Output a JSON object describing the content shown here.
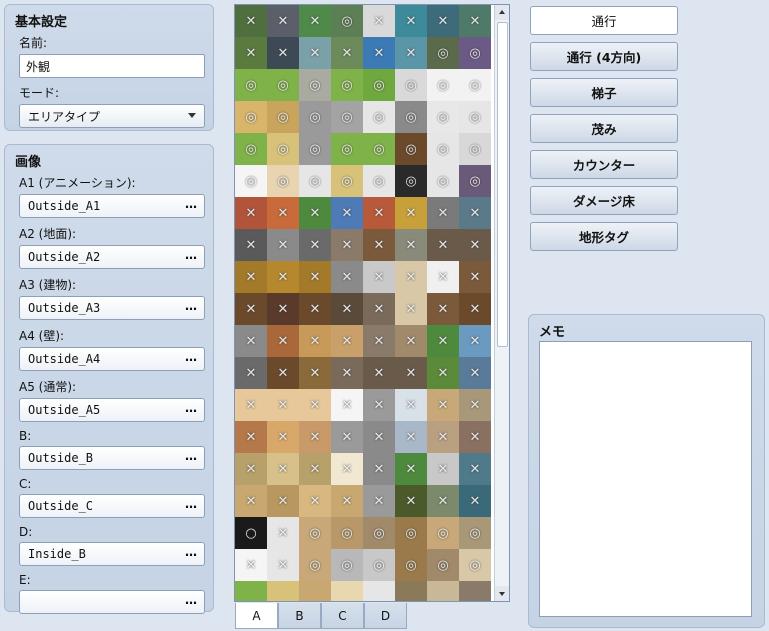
{
  "basic": {
    "title": "基本設定",
    "name_label": "名前:",
    "name_value": "外観",
    "mode_label": "モード:",
    "mode_value": "エリアタイプ"
  },
  "images": {
    "title": "画像",
    "browse_label": "…",
    "items": [
      {
        "label": "A1 (アニメーション):",
        "value": "Outside_A1"
      },
      {
        "label": "A2 (地面):",
        "value": "Outside_A2"
      },
      {
        "label": "A3 (建物):",
        "value": "Outside_A3"
      },
      {
        "label": "A4 (壁):",
        "value": "Outside_A4"
      },
      {
        "label": "A5 (通常):",
        "value": "Outside_A5"
      },
      {
        "label": "B:",
        "value": "Outside_B"
      },
      {
        "label": "C:",
        "value": "Outside_C"
      },
      {
        "label": "D:",
        "value": "Inside_B"
      },
      {
        "label": "E:",
        "value": ""
      }
    ]
  },
  "tileset": {
    "tabs": [
      "A",
      "B",
      "C",
      "D"
    ],
    "active_tab": "A",
    "rows": [
      {
        "colors": [
          "#4f6f3e",
          "#5a5f6a",
          "#4f8a4a",
          "#5d7f55",
          "#d9d9d9",
          "#3c8a9a",
          "#3d6b7a",
          "#4f7a6a"
        ],
        "marks": [
          "✕",
          "✕",
          "✕",
          "◎",
          "✕",
          "✕",
          "✕",
          "✕"
        ]
      },
      {
        "colors": [
          "#5a7a3e",
          "#3d4a55",
          "#7aa0a8",
          "#6c8a5a",
          "#3b7ab5",
          "#5b95a8",
          "#5a6a4a",
          "#6b5a85"
        ],
        "marks": [
          "✕",
          "✕",
          "✕",
          "✕",
          "✕",
          "✕",
          "◎",
          "◎"
        ]
      },
      {
        "colors": [
          "#7fb34a",
          "#7fb34a",
          "#a9aaa0",
          "#7fb34a",
          "#6fa83e",
          "#d9d9d9",
          "#f2f2f2",
          "#f2f2f2"
        ],
        "marks": [
          "◎",
          "◎",
          "◎",
          "◎",
          "◎",
          "◎",
          "◎",
          "◎"
        ]
      },
      {
        "colors": [
          "#d8b56a",
          "#c9a45c",
          "#9a9a9a",
          "#a3a3a3",
          "#e6e6e6",
          "#8a8a8a",
          "#e8e8e8",
          "#e6e6e6"
        ],
        "marks": [
          "◎",
          "◎",
          "◎",
          "◎",
          "◎",
          "◎",
          "◎",
          "◎"
        ]
      },
      {
        "colors": [
          "#7fb34a",
          "#d8c27a",
          "#9a9a9a",
          "#7fb34a",
          "#7fb34a",
          "#6a4a2a",
          "#e6e6e6",
          "#d8d8d8"
        ],
        "marks": [
          "◎",
          "◎",
          "◎",
          "◎",
          "◎",
          "◎",
          "◎",
          "◎"
        ]
      },
      {
        "colors": [
          "#f5f5f5",
          "#e8d4b0",
          "#e6e6e6",
          "#d8c27a",
          "#e6e6e6",
          "#2a2a2a",
          "#e6e6e6",
          "#6a5a7a"
        ],
        "marks": [
          "◎",
          "◎",
          "◎",
          "◎",
          "◎",
          "◎",
          "◎",
          "◎"
        ]
      },
      {
        "colors": [
          "#b2543a",
          "#c86a3a",
          "#4e8a3e",
          "#4e7ab5",
          "#b85a3a",
          "#c8a03a",
          "#7a7a7a",
          "#5a7a8a"
        ],
        "marks": [
          "✕",
          "✕",
          "✕",
          "✕",
          "✕",
          "✕",
          "✕",
          "✕"
        ]
      },
      {
        "colors": [
          "#5a5a5a",
          "#8a8a8a",
          "#6a6a6a",
          "#8a7a6a",
          "#7a5a3a",
          "#8a8a7a",
          "#6a5a4a",
          "#6a5a4a"
        ],
        "marks": [
          "✕",
          "✕",
          "✕",
          "✕",
          "✕",
          "✕",
          "✕",
          "✕"
        ]
      },
      {
        "colors": [
          "#a37a2a",
          "#b5882e",
          "#a37a2a",
          "#8a8a8a",
          "#c9c9c9",
          "#d8c8a8",
          "#f0f0f0",
          "#7a5a3a"
        ],
        "marks": [
          "✕",
          "✕",
          "✕",
          "✕",
          "✕",
          "✕",
          "✕",
          "✕"
        ]
      },
      {
        "colors": [
          "#6a4a2a",
          "#5a3a2a",
          "#6a4a2a",
          "#5a4a3a",
          "#7a6a5a",
          "#d8c8a8",
          "#7a5a3a",
          "#6a4a2a"
        ],
        "marks": [
          "✕",
          "✕",
          "✕",
          "✕",
          "✕",
          "✕",
          "✕",
          "✕"
        ]
      },
      {
        "colors": [
          "#8a8a8a",
          "#a8683a",
          "#c89a5a",
          "#c9a06a",
          "#8a7a6a",
          "#a08a6a",
          "#4e8a3e",
          "#6a9ac0"
        ],
        "marks": [
          "✕",
          "✕",
          "✕",
          "✕",
          "✕",
          "✕",
          "✕",
          "✕"
        ]
      },
      {
        "colors": [
          "#6a6a6a",
          "#6a4a2a",
          "#8a6a3a",
          "#7a6a5a",
          "#6a5a4a",
          "#6a5a4a",
          "#5a8a3a",
          "#5a7a9a"
        ],
        "marks": [
          "✕",
          "✕",
          "✕",
          "✕",
          "✕",
          "✕",
          "✕",
          "✕"
        ]
      },
      {
        "colors": [
          "#e6c89a",
          "#e6c89a",
          "#e6c89a",
          "#f5f5f5",
          "#9a9a9a",
          "#d8e0e8",
          "#c8a878",
          "#a8987a"
        ],
        "marks": [
          "✕",
          "✕",
          "✕",
          "✕",
          "✕",
          "✕",
          "✕",
          "✕"
        ]
      },
      {
        "colors": [
          "#b5784a",
          "#d8a86a",
          "#c89a6a",
          "#9a9a9a",
          "#8a8a8a",
          "#a8b8c8",
          "#b8a080",
          "#8a7060"
        ],
        "marks": [
          "✕",
          "✕",
          "✕",
          "✕",
          "✕",
          "✕",
          "✕",
          "✕"
        ]
      },
      {
        "colors": [
          "#b8a06a",
          "#d8c08a",
          "#b8a06a",
          "#f0e8d0",
          "#8a8a8a",
          "#4e8a3e",
          "#c8c8c8",
          "#4e7a8a"
        ],
        "marks": [
          "✕",
          "✕",
          "✕",
          "✕",
          "✕",
          "✕",
          "✕",
          "✕"
        ]
      },
      {
        "colors": [
          "#c8a870",
          "#b89860",
          "#d8b880",
          "#c8a870",
          "#9a9a9a",
          "#4a5a2a",
          "#7a8a6a",
          "#3a6a7a"
        ],
        "marks": [
          "✕",
          "✕",
          "✕",
          "✕",
          "✕",
          "✕",
          "✕",
          "✕"
        ]
      },
      {
        "colors": [
          "#1a1a1a",
          "#e6e6e6",
          "#c8a878",
          "#b89868",
          "#a08a6a",
          "#9a7a4a",
          "#c8a878",
          "#a89878"
        ],
        "marks": [
          "○",
          "✕",
          "◎",
          "◎",
          "◎",
          "◎",
          "◎",
          "◎"
        ]
      },
      {
        "colors": [
          "#f5f5f5",
          "#e6e6e6",
          "#c8a878",
          "#b8b8b8",
          "#c8c8c8",
          "#9a7a4a",
          "#a08a6a",
          "#d8c8a8"
        ],
        "marks": [
          "✕",
          "✕",
          "◎",
          "◎",
          "◎",
          "◎",
          "◎",
          "◎"
        ]
      },
      {
        "colors": [
          "#7fb34a",
          "#d8c27a",
          "#c8a870",
          "#e8d8b0",
          "#e6e6e6",
          "#8a7a5a",
          "#c8b898",
          "#8a7a6a"
        ],
        "marks": [
          "",
          "",
          "",
          "",
          "",
          "",
          "",
          ""
        ]
      }
    ]
  },
  "buttons": [
    "通行",
    "通行 (4方向)",
    "梯子",
    "茂み",
    "カウンター",
    "ダメージ床",
    "地形タグ"
  ],
  "memo": {
    "title": "メモ",
    "value": ""
  }
}
